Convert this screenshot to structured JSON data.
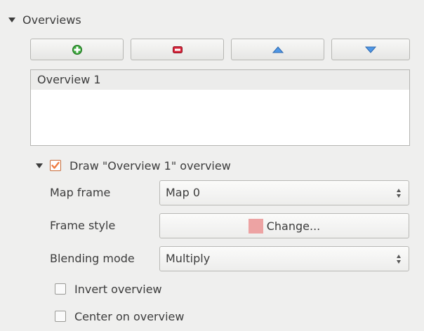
{
  "overviews": {
    "title": "Overviews",
    "toolbar": {
      "add_icon": "plus-icon",
      "remove_icon": "minus-icon",
      "up_icon": "arrow-up-icon",
      "down_icon": "arrow-down-icon"
    },
    "list": [
      "Overview 1"
    ]
  },
  "overview_settings": {
    "draw_label": "Draw \"Overview 1\" overview",
    "draw_checked": true,
    "map_frame_label": "Map frame",
    "map_frame_value": "Map 0",
    "frame_style_label": "Frame style",
    "frame_style_button": "Change...",
    "frame_style_swatch": "#eda3a3",
    "blending_mode_label": "Blending mode",
    "blending_mode_value": "Multiply",
    "invert_label": "Invert overview",
    "invert_checked": false,
    "center_label": "Center on overview",
    "center_checked": false
  },
  "colors": {
    "accent": "#f07d42",
    "add_green": "#3aa83a",
    "remove_red": "#d8243a",
    "arrow_blue": "#3f86d8"
  }
}
